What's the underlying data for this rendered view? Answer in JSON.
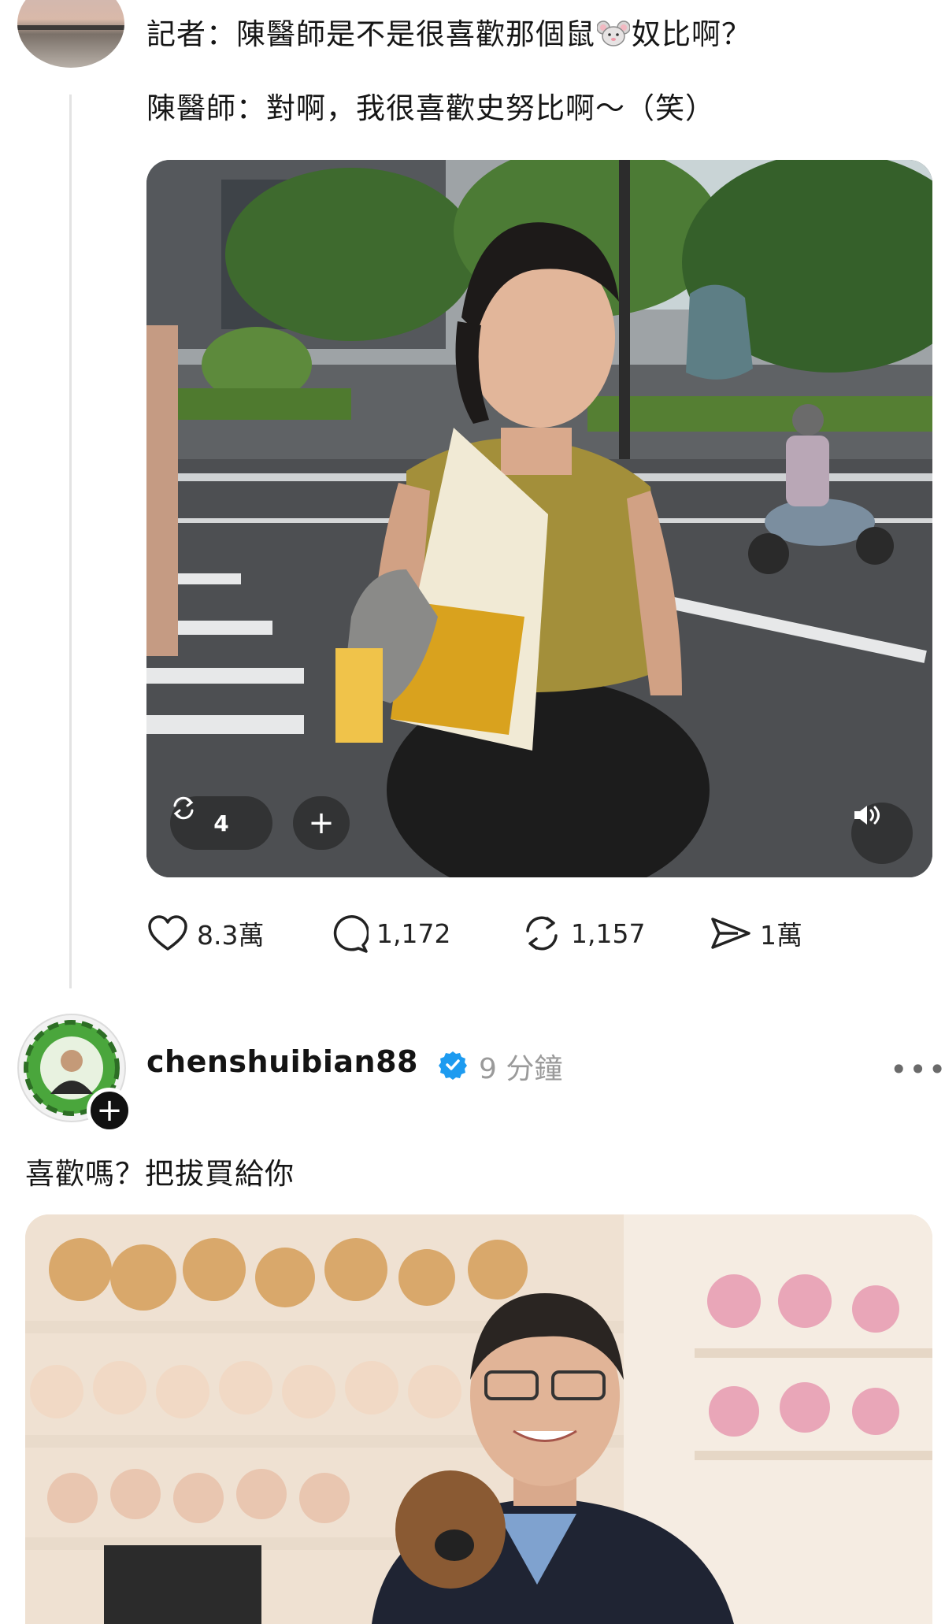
{
  "post1": {
    "line1_prefix": "記者：陳醫師是不是很喜歡那個鼠",
    "line1_emoji": "mouse-face-emoji",
    "line1_suffix": "奴比啊？",
    "line2": "陳醫師：對啊，我很喜歡史努比啊～（笑）",
    "media": {
      "repost_count": "4",
      "plus_label": "+",
      "sound_icon": "speaker-icon"
    },
    "stats": {
      "likes": "8.3萬",
      "comments": "1,172",
      "reposts": "1,157",
      "shares": "1萬"
    }
  },
  "post2": {
    "username": "chenshuibian88",
    "verified_icon": "verified-badge-icon",
    "time": "9 分鐘",
    "more_label": "•••",
    "follow_label": "+",
    "text": "喜歡嗎？把拔買給你"
  },
  "colors": {
    "verified_blue": "#1d9bf0",
    "thread_line": "#e3e3e3",
    "muted_text": "#9a9a9a"
  }
}
